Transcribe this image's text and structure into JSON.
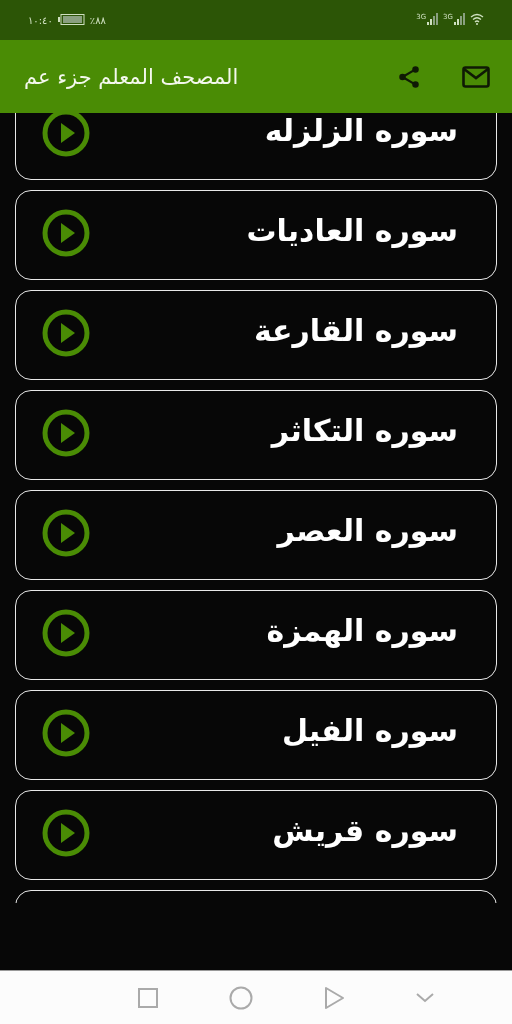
{
  "status_bar": {
    "time": "١٠:٤٠",
    "battery": "٪٨٨",
    "networks": [
      "3G",
      "3G"
    ]
  },
  "app_bar": {
    "title": "المصحف المعلم جزء عم"
  },
  "suras": [
    {
      "kind": "sura",
      "title": "سوره الزلزله"
    },
    {
      "kind": "sura",
      "title": "سوره العاديات"
    },
    {
      "kind": "sura",
      "title": "سوره القارعة"
    },
    {
      "kind": "sura",
      "title": "سوره التكاثر"
    },
    {
      "kind": "sura",
      "title": "سوره العصر"
    },
    {
      "kind": "sura",
      "title": "سوره الهمزة"
    },
    {
      "kind": "sura",
      "title": "سوره الفيل"
    },
    {
      "kind": "sura",
      "title": "سوره قريش"
    },
    {
      "kind": "clipped"
    }
  ]
}
